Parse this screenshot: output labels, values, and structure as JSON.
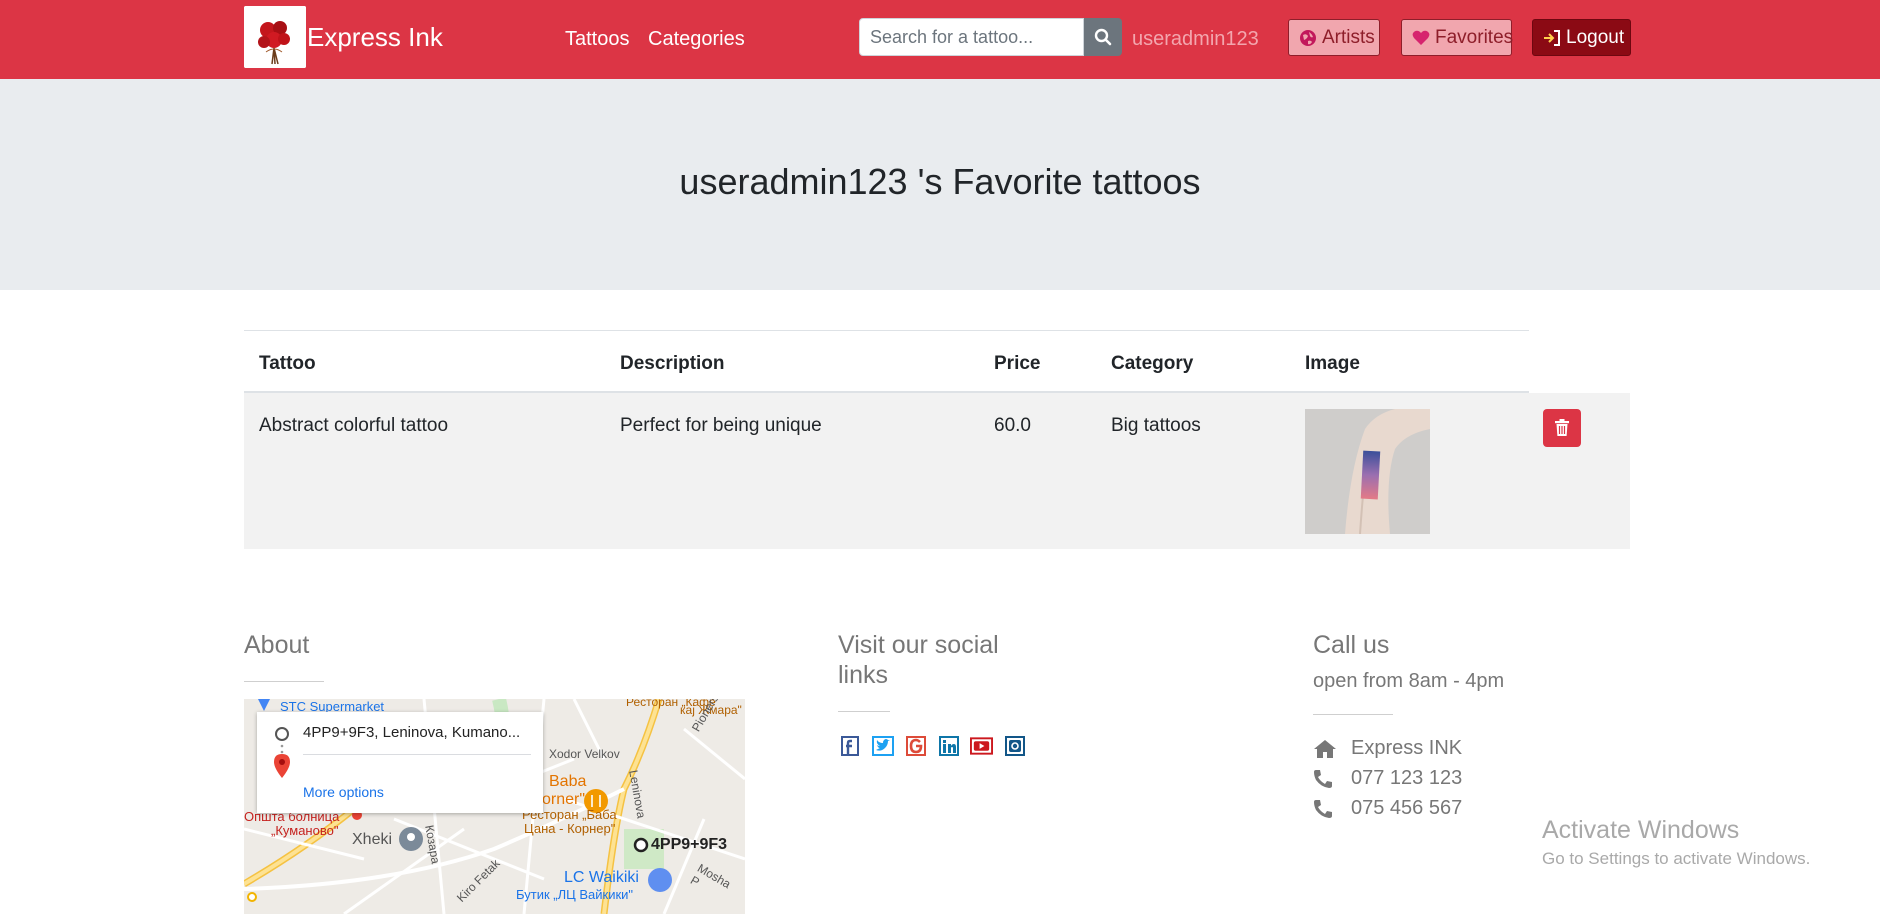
{
  "header": {
    "brand": "Express Ink",
    "nav": [
      "Tattoos",
      "Categories"
    ],
    "search_placeholder": "Search for a tattoo...",
    "username": "useradmin123",
    "buttons": {
      "artists": "Artists",
      "favorites": "Favorites",
      "logout": "Logout"
    }
  },
  "jumbotron": {
    "title": "useradmin123 's Favorite tattoos"
  },
  "table": {
    "headers": [
      "Tattoo",
      "Description",
      "Price",
      "Category",
      "Image"
    ],
    "rows": [
      {
        "tattoo": "Abstract colorful tattoo",
        "description": "Perfect for being unique",
        "price": "60.0",
        "category": "Big tattoos"
      }
    ]
  },
  "footer": {
    "about": {
      "title": "About",
      "map": {
        "address": "4PP9+9F3, Leninova, Kumano...",
        "more_options": "More options",
        "labels": [
          "STC Supermarket",
          "Ресторан „Кафе",
          "кај Жмара\"",
          "Xodor Velkov",
          "Leninova",
          "Pionerska",
          "Baba",
          "orner\"",
          "Ресторан „Баба",
          "Цана - Корнер\"",
          "Општа болница",
          "„Куманово\"",
          "Xheki",
          "Козара",
          "4PP9+9F3",
          "Kiro Fetak",
          "LC Waikiki",
          "Бутик „ЛЦ Вайкики\"",
          "Mosha P"
        ]
      }
    },
    "social": {
      "title_line1": "Visit our social",
      "title_line2": "links",
      "icons": [
        "facebook-icon",
        "twitter-icon",
        "google-icon",
        "linkedin-icon",
        "youtube-icon",
        "instagram-icon"
      ]
    },
    "call": {
      "title": "Call us",
      "hours": "open from 8am - 4pm",
      "company": "Express INK",
      "phone1": "077 123 123",
      "phone2": "075 456 567"
    }
  },
  "watermark": {
    "line1": "Activate Windows",
    "line2": "Go to Settings to activate Windows."
  },
  "colors": {
    "brand_red": "#dc3545",
    "logout_dark": "#8b0a14",
    "jumbotron_gray": "#e9ecef",
    "username_pink": "#f3a6ae"
  }
}
